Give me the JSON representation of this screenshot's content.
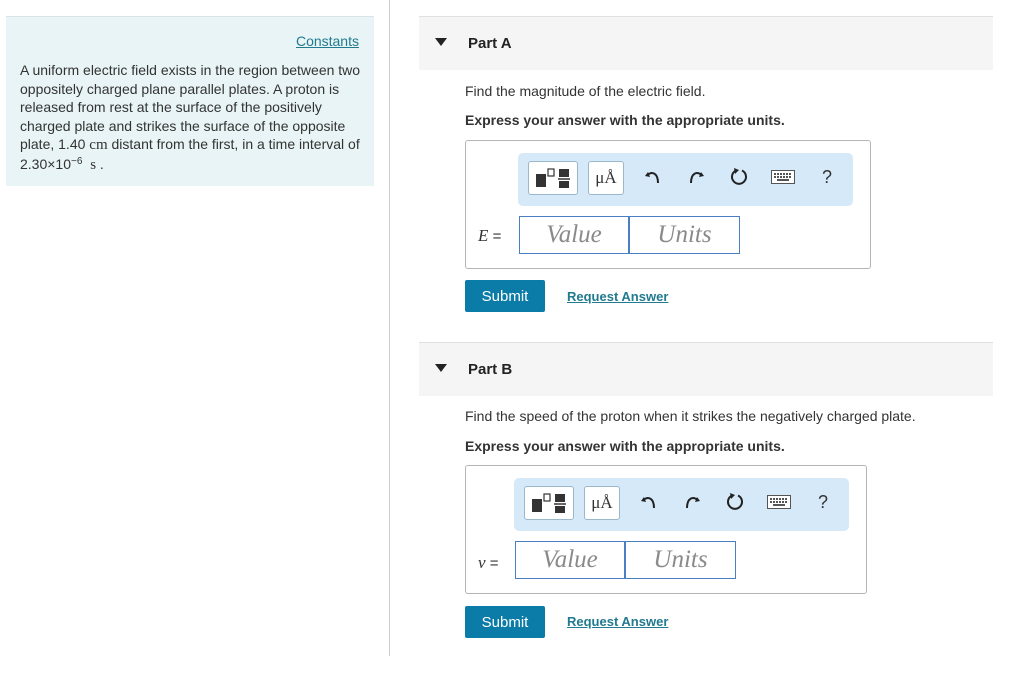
{
  "problem": {
    "constants_label": "Constants",
    "text_1": "A uniform electric field exists in the region between two oppositely charged plane parallel plates. A proton is released from rest at the surface of the positively charged plate and strikes the surface of the opposite plate, 1.40 ",
    "unit_cm": "cm",
    "text_2": " distant from the first, in a time interval of 2.30×10",
    "exponent": "−6",
    "unit_s": "s",
    "text_end": " ."
  },
  "parts": [
    {
      "title": "Part A",
      "question": "Find the magnitude of the electric field.",
      "instruction": "Express your answer with the appropriate units.",
      "variable": "E",
      "equals": "=",
      "value_placeholder": "Value",
      "units_placeholder": "Units",
      "submit_label": "Submit",
      "request_label": "Request Answer"
    },
    {
      "title": "Part B",
      "question": "Find the speed of the proton when it strikes the negatively charged plate.",
      "instruction": "Express your answer with the appropriate units.",
      "variable": "v",
      "equals": "=",
      "value_placeholder": "Value",
      "units_placeholder": "Units",
      "submit_label": "Submit",
      "request_label": "Request Answer"
    }
  ],
  "toolbar": {
    "units_symbol": "μÅ",
    "help_symbol": "?",
    "icons": [
      "templates-icon",
      "units-icon",
      "undo-icon",
      "redo-icon",
      "reset-icon",
      "keyboard-icon",
      "help-icon"
    ]
  },
  "colors": {
    "panel_bg": "#e8f4f5",
    "link": "#217a8f",
    "submit_bg": "#0b7ba8",
    "toolbar_bg": "#d6e9f8",
    "field_border": "#4a7fc1"
  }
}
